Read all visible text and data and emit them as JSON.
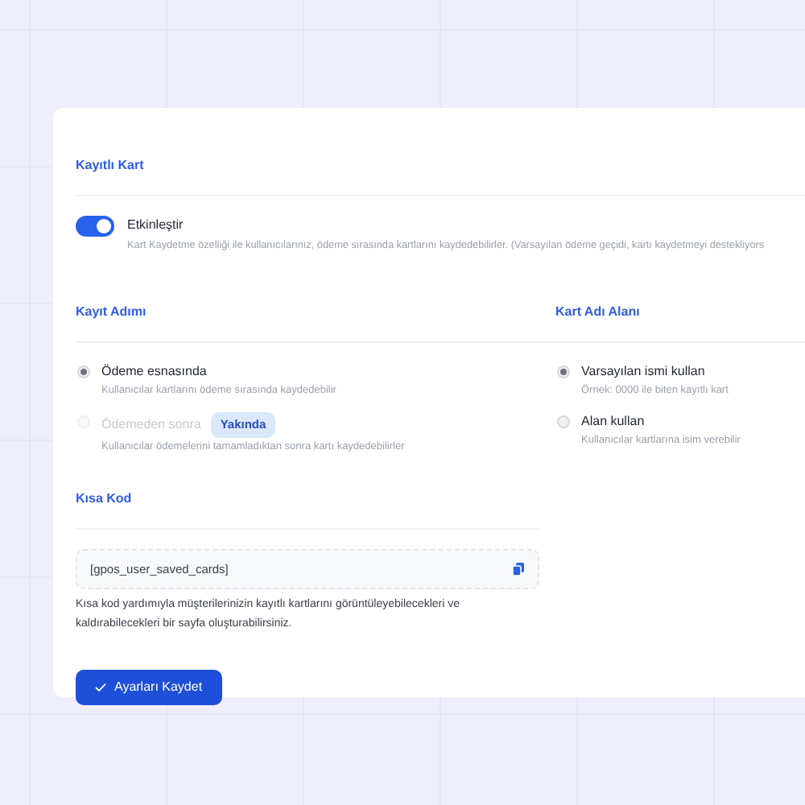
{
  "saved_card": {
    "title": "Kayıtlı Kart",
    "toggle": {
      "label": "Etkinleştir",
      "on": true,
      "description": "Kart Kaydetme özelliği ile kullanıcılarınız, ödeme sırasında kartlarını kaydedebilirler. (Varsayılan ödeme geçidi, kartı kaydetmeyi destekliyors"
    }
  },
  "save_step": {
    "title": "Kayıt Adımı",
    "options": [
      {
        "label": "Ödeme esnasında",
        "description": "Kullanıcılar kartlarını ödeme sırasında kaydedebilir",
        "selected": true,
        "disabled": false
      },
      {
        "label": "Ödemeden sonra",
        "badge": "Yakında",
        "description": "Kullanıcılar ödemelerini tamamladıktan sonra kartı kaydedebilirler",
        "selected": false,
        "disabled": true
      }
    ]
  },
  "card_name_field": {
    "title": "Kart Adı Alanı",
    "options": [
      {
        "label": "Varsayılan ismi kullan",
        "description": "Örnek: 0000 ile biten kayıtlı kart",
        "selected": true,
        "disabled": false
      },
      {
        "label": "Alan kullan",
        "description": "Kullanıcılar kartlarına isim verebilir",
        "selected": false,
        "disabled": false
      }
    ]
  },
  "shortcode": {
    "title": "Kısa Kod",
    "value": "[gpos_user_saved_cards]",
    "help": "Kısa kod yardımıyla müşterilerinizin kayıtlı kartlarını görüntüleyebilecekleri ve kaldırabilecekleri bir sayfa oluşturabilirsiniz."
  },
  "save_button": "Ayarları Kaydet"
}
